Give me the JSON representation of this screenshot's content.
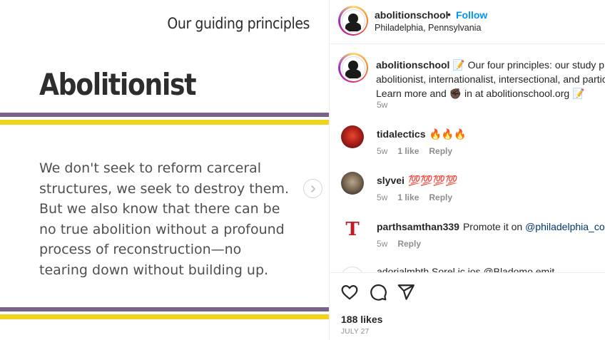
{
  "slide": {
    "heading": "Our guiding principles",
    "title": "Abolitionist",
    "body": "We don't seek to reform carceral\nstructures, we seek to destroy them.\nBut we also know that there can be\nno true abolition without a profound\nprocess of reconstruction—no\ntearing down without building up.",
    "stripe_colors": {
      "purple": "#7a6388",
      "yellow": "#f3d21b"
    },
    "next_icon": "chevron-right-icon"
  },
  "header": {
    "username": "abolitionschool",
    "separator": "•",
    "follow_label": "Follow",
    "location": "Philadelphia, Pennsylvania"
  },
  "caption": {
    "username": "abolitionschool",
    "line1": "📝 Our four principles: our study pro",
    "line2": "abolitionist, internationalist, intersectional, and partici",
    "line3": "Learn more and ✊🏿 in at abolitionschool.org 📝",
    "age": "5w"
  },
  "comments": [
    {
      "username": "tidalectics",
      "text": "🔥🔥🔥",
      "age": "5w",
      "likes": "1 like",
      "reply": "Reply"
    },
    {
      "username": "slyvei",
      "text": "💯💯💯💯",
      "age": "5w",
      "likes": "1 like",
      "reply": "Reply"
    },
    {
      "username": "parthsamthan339",
      "text": "Promote it on ",
      "mention": "@philadelphia_comm",
      "age": "5w",
      "reply": "Reply"
    }
  ],
  "partial_comment": "adorialmbth Sorel ic ios @Bladomo emit",
  "actions": {
    "like_icon": "heart-icon",
    "comment_icon": "comment-icon",
    "share_icon": "share-icon",
    "likes": "188 likes",
    "date": "JULY 27"
  },
  "colors": {
    "accent": "#0095f6",
    "mention": "#00376b",
    "muted": "#8e8e8e"
  }
}
